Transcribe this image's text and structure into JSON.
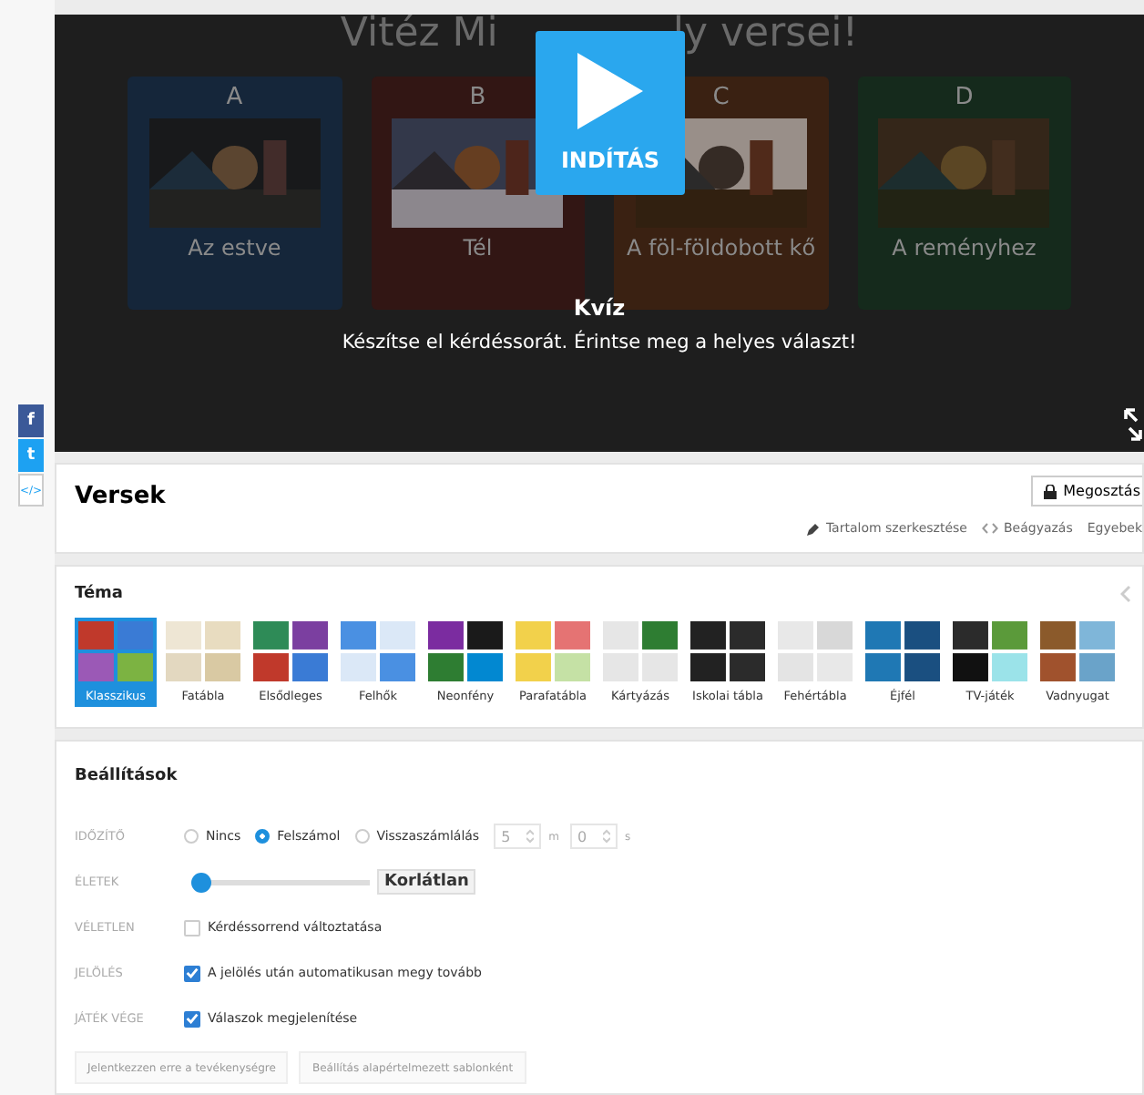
{
  "social": [
    "f",
    "t",
    "</>"
  ],
  "preview": {
    "background_title": [
      "Vitéz Mi",
      "ly versei!"
    ],
    "cards": [
      {
        "letter": "A",
        "label": "Az estve",
        "color": "#15263a"
      },
      {
        "letter": "B",
        "label": "Tél",
        "color": "#321614"
      },
      {
        "letter": "C",
        "label": "A föl-földobott kő",
        "color": "#3a2112"
      },
      {
        "letter": "D",
        "label": "A reményhez",
        "color": "#152a1c"
      }
    ],
    "start_button": "INDÍTÁS",
    "activity_type": "Kvíz",
    "description": "Készítse el kérdéssorát. Érintse meg a helyes választ!"
  },
  "header": {
    "title": "Versek",
    "share_button": "Megosztás",
    "links": [
      "Tartalom szerkesztése",
      "Beágyazás",
      "Egyebek"
    ]
  },
  "theme": {
    "title": "Téma",
    "items": [
      {
        "label": "Klasszikus",
        "selected": true
      },
      {
        "label": "Fatábla",
        "selected": false
      },
      {
        "label": "Elsődleges",
        "selected": false
      },
      {
        "label": "Felhők",
        "selected": false
      },
      {
        "label": "Neonfény",
        "selected": false
      },
      {
        "label": "Parafatábla",
        "selected": false
      },
      {
        "label": "Kártyázás",
        "selected": false
      },
      {
        "label": "Iskolai tábla",
        "selected": false
      },
      {
        "label": "Fehértábla",
        "selected": false
      },
      {
        "label": "Éjfél",
        "selected": false
      },
      {
        "label": "TV-játék",
        "selected": false
      },
      {
        "label": "Vadnyugat",
        "selected": false
      }
    ]
  },
  "settings": {
    "title": "Beállítások",
    "rows": [
      {
        "kind": "radio",
        "label": "IDŐZÍTŐ",
        "options": [
          {
            "label": "Nincs",
            "selected": false
          },
          {
            "label": "Felszámol",
            "selected": true
          },
          {
            "label": "Visszaszámlálás",
            "selected": false
          }
        ],
        "minutes": "5",
        "minutes_unit": "m",
        "seconds": "0",
        "seconds_unit": "s"
      },
      {
        "kind": "slider",
        "label": "ÉLETEK",
        "level": 0,
        "value": "Korlátlan"
      },
      {
        "kind": "checkbox",
        "label": "VÉLETLEN",
        "text": "Kérdéssorrend változtatása",
        "checked": false
      },
      {
        "kind": "checkbox",
        "label": "JELÖLÉS",
        "text": "A jelölés után automatikusan megy tovább",
        "checked": true
      },
      {
        "kind": "checkbox",
        "label": "JÁTÉK VÉGE",
        "text": "Válaszok megjelenítése",
        "checked": true
      }
    ],
    "buttons": [
      {
        "label": "Jelentkezzen erre a tevékenységre",
        "disabled": true
      },
      {
        "label": "Beállítás alapértelmezett sablonként",
        "disabled": true
      }
    ]
  }
}
